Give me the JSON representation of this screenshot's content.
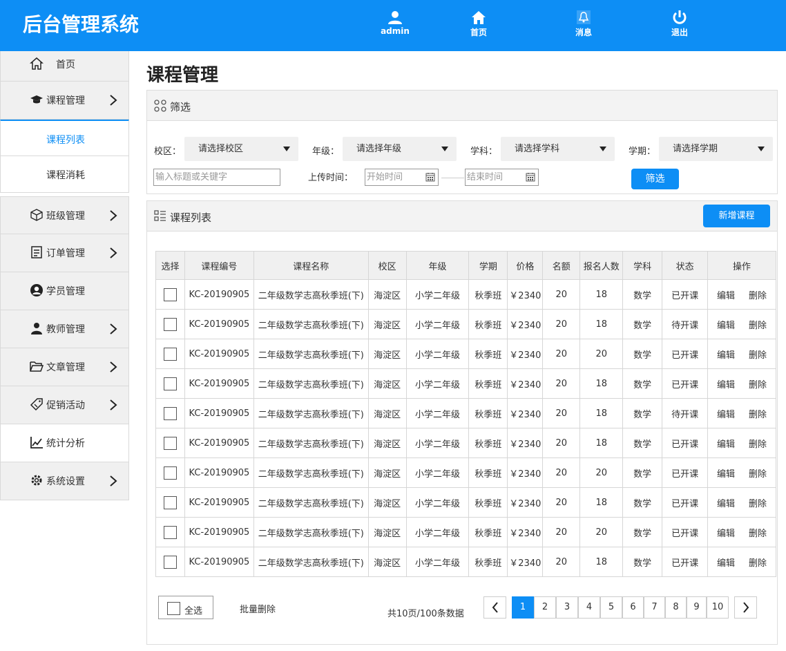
{
  "header": {
    "logo": "后台管理系统",
    "nav": [
      {
        "label": "admin",
        "icon": "user-icon"
      },
      {
        "label": "首页",
        "icon": "home-icon"
      },
      {
        "label": "消息",
        "icon": "bell-icon"
      },
      {
        "label": "退出",
        "icon": "power-icon"
      }
    ]
  },
  "sidebar": {
    "home": "首页",
    "course_mgmt": "课程管理",
    "sub_course_list": "课程列表",
    "sub_course_consume": "课程消耗",
    "class_mgmt": "班级管理",
    "order_mgmt": "订单管理",
    "student_mgmt": "学员管理",
    "teacher_mgmt": "教师管理",
    "article_mgmt": "文章管理",
    "promo": "促销活动",
    "stats": "统计分析",
    "settings": "系统设置"
  },
  "page_title": "课程管理",
  "filter": {
    "title": "筛选",
    "campus_label": "校区：",
    "campus_value": "请选择校区",
    "grade_label": "年级：",
    "grade_value": "请选择年级",
    "subject_label": "学科：",
    "subject_value": "请选择学科",
    "term_label": "学期：",
    "term_value": "请选择学期",
    "keyword_placeholder": "输入标题或关键字",
    "upload_label": "上传时间：",
    "start_placeholder": "开始时间",
    "end_placeholder": "结束时间",
    "button": "筛选"
  },
  "list": {
    "title": "课程列表",
    "add_button": "新增课程",
    "columns": [
      "选择",
      "课程编号",
      "课程名称",
      "校区",
      "年级",
      "学期",
      "价格",
      "名额",
      "报名人数",
      "学科",
      "状态",
      "操作"
    ],
    "edit": "编辑",
    "delete": "删除",
    "rows": [
      {
        "id": "KC-20190905",
        "name": "二年级数学志高秋季班(下)",
        "campus": "海淀区",
        "grade": "小学二年级",
        "term": "秋季班",
        "price": "￥2340",
        "quota": "20",
        "enrolled": "18",
        "subject": "数学",
        "status": "已开课"
      },
      {
        "id": "KC-20190905",
        "name": "二年级数学志高秋季班(下)",
        "campus": "海淀区",
        "grade": "小学二年级",
        "term": "秋季班",
        "price": "￥2340",
        "quota": "20",
        "enrolled": "18",
        "subject": "数学",
        "status": "待开课"
      },
      {
        "id": "KC-20190905",
        "name": "二年级数学志高秋季班(下)",
        "campus": "海淀区",
        "grade": "小学二年级",
        "term": "秋季班",
        "price": "￥2340",
        "quota": "20",
        "enrolled": "20",
        "subject": "数学",
        "status": "已开课"
      },
      {
        "id": "KC-20190905",
        "name": "二年级数学志高秋季班(下)",
        "campus": "海淀区",
        "grade": "小学二年级",
        "term": "秋季班",
        "price": "￥2340",
        "quota": "20",
        "enrolled": "18",
        "subject": "数学",
        "status": "已开课"
      },
      {
        "id": "KC-20190905",
        "name": "二年级数学志高秋季班(下)",
        "campus": "海淀区",
        "grade": "小学二年级",
        "term": "秋季班",
        "price": "￥2340",
        "quota": "20",
        "enrolled": "18",
        "subject": "数学",
        "status": "待开课"
      },
      {
        "id": "KC-20190905",
        "name": "二年级数学志高秋季班(下)",
        "campus": "海淀区",
        "grade": "小学二年级",
        "term": "秋季班",
        "price": "￥2340",
        "quota": "20",
        "enrolled": "18",
        "subject": "数学",
        "status": "已开课"
      },
      {
        "id": "KC-20190905",
        "name": "二年级数学志高秋季班(下)",
        "campus": "海淀区",
        "grade": "小学二年级",
        "term": "秋季班",
        "price": "￥2340",
        "quota": "20",
        "enrolled": "20",
        "subject": "数学",
        "status": "已开课"
      },
      {
        "id": "KC-20190905",
        "name": "二年级数学志高秋季班(下)",
        "campus": "海淀区",
        "grade": "小学二年级",
        "term": "秋季班",
        "price": "￥2340",
        "quota": "20",
        "enrolled": "18",
        "subject": "数学",
        "status": "已开课"
      },
      {
        "id": "KC-20190905",
        "name": "二年级数学志高秋季班(下)",
        "campus": "海淀区",
        "grade": "小学二年级",
        "term": "秋季班",
        "price": "￥2340",
        "quota": "20",
        "enrolled": "20",
        "subject": "数学",
        "status": "已开课"
      },
      {
        "id": "KC-20190905",
        "name": "二年级数学志高秋季班(下)",
        "campus": "海淀区",
        "grade": "小学二年级",
        "term": "秋季班",
        "price": "￥2340",
        "quota": "20",
        "enrolled": "18",
        "subject": "数学",
        "status": "已开课"
      }
    ]
  },
  "footer": {
    "select_all": "全选",
    "batch_delete": "批量删除",
    "summary": "共10页/100条数据",
    "pages": [
      "1",
      "2",
      "3",
      "4",
      "5",
      "6",
      "7",
      "8",
      "9",
      "10"
    ],
    "current_page": "1"
  },
  "colors": {
    "brand": "#0d8ef5"
  }
}
